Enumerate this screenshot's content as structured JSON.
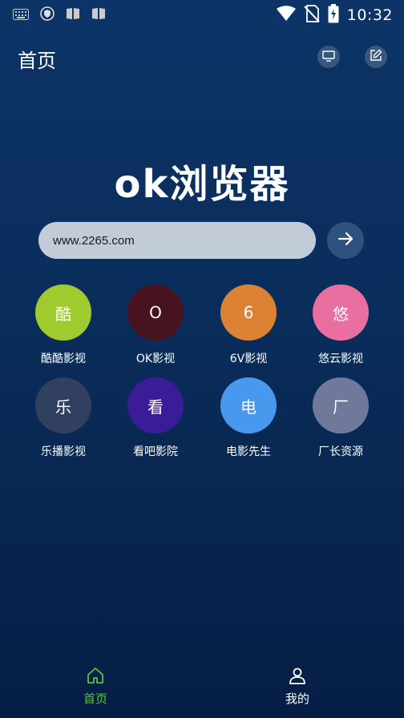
{
  "status_bar": {
    "time": "10:32",
    "left_icons": [
      "keyboard-icon",
      "shield-icon",
      "book-icon",
      "book-icon"
    ],
    "right_icons": [
      "wifi-icon",
      "no-sim-icon",
      "battery-charging-icon"
    ]
  },
  "header": {
    "title": "首页",
    "icons": [
      "tv-icon",
      "edit-icon"
    ]
  },
  "logo": {
    "text": "ok浏览器"
  },
  "search": {
    "value": "www.2265.com",
    "go_icon": "arrow-right-icon"
  },
  "sites": [
    {
      "glyph": "酷",
      "label": "酷酷影视",
      "color": "#9fcb2f"
    },
    {
      "glyph": "O",
      "label": "OK影视",
      "color": "#471320"
    },
    {
      "glyph": "6",
      "label": "6V影视",
      "color": "#db8234"
    },
    {
      "glyph": "悠",
      "label": "悠云影视",
      "color": "#e86f9f"
    },
    {
      "glyph": "乐",
      "label": "乐播影视",
      "color": "#30405e"
    },
    {
      "glyph": "看",
      "label": "看吧影院",
      "color": "#3b1c98"
    },
    {
      "glyph": "电",
      "label": "电影先生",
      "color": "#4899ee"
    },
    {
      "glyph": "厂",
      "label": "厂长资源",
      "color": "#71799a"
    }
  ],
  "tabs": [
    {
      "label": "首页",
      "icon": "home-icon",
      "active": true,
      "color": "#5bc236"
    },
    {
      "label": "我的",
      "icon": "person-icon",
      "active": false,
      "color": "#ffffff"
    }
  ]
}
